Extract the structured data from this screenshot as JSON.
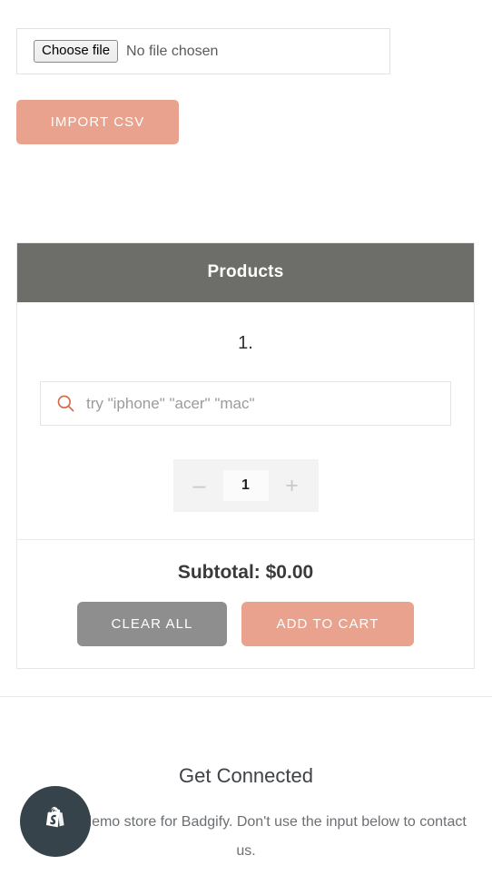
{
  "import": {
    "file_button_label": "Choose file",
    "file_status": "No file chosen",
    "import_button_label": "IMPORT CSV"
  },
  "products": {
    "header_title": "Products",
    "rows": [
      {
        "index_label": "1.",
        "search_placeholder": "try \"iphone\" \"acer\" \"mac\"",
        "search_value": "",
        "search_icon": "search-icon",
        "quantity": "1",
        "decrement_label": "–",
        "increment_label": "+"
      }
    ],
    "subtotal_label": "Subtotal: $0.00",
    "clear_button_label": "CLEAR ALL",
    "add_button_label": "ADD TO CART"
  },
  "footer": {
    "title": "Get Connected",
    "description": "This is a demo store for Badgify. Don't use the input below to contact us.",
    "badge_icon": "shopify-bag-icon"
  },
  "colors": {
    "accent_salmon": "#e8a28d",
    "header_gray": "#6d6d69",
    "clear_gray": "#8e8e8e",
    "search_icon_orange": "#d2664a",
    "badge_dark": "#36434a"
  }
}
